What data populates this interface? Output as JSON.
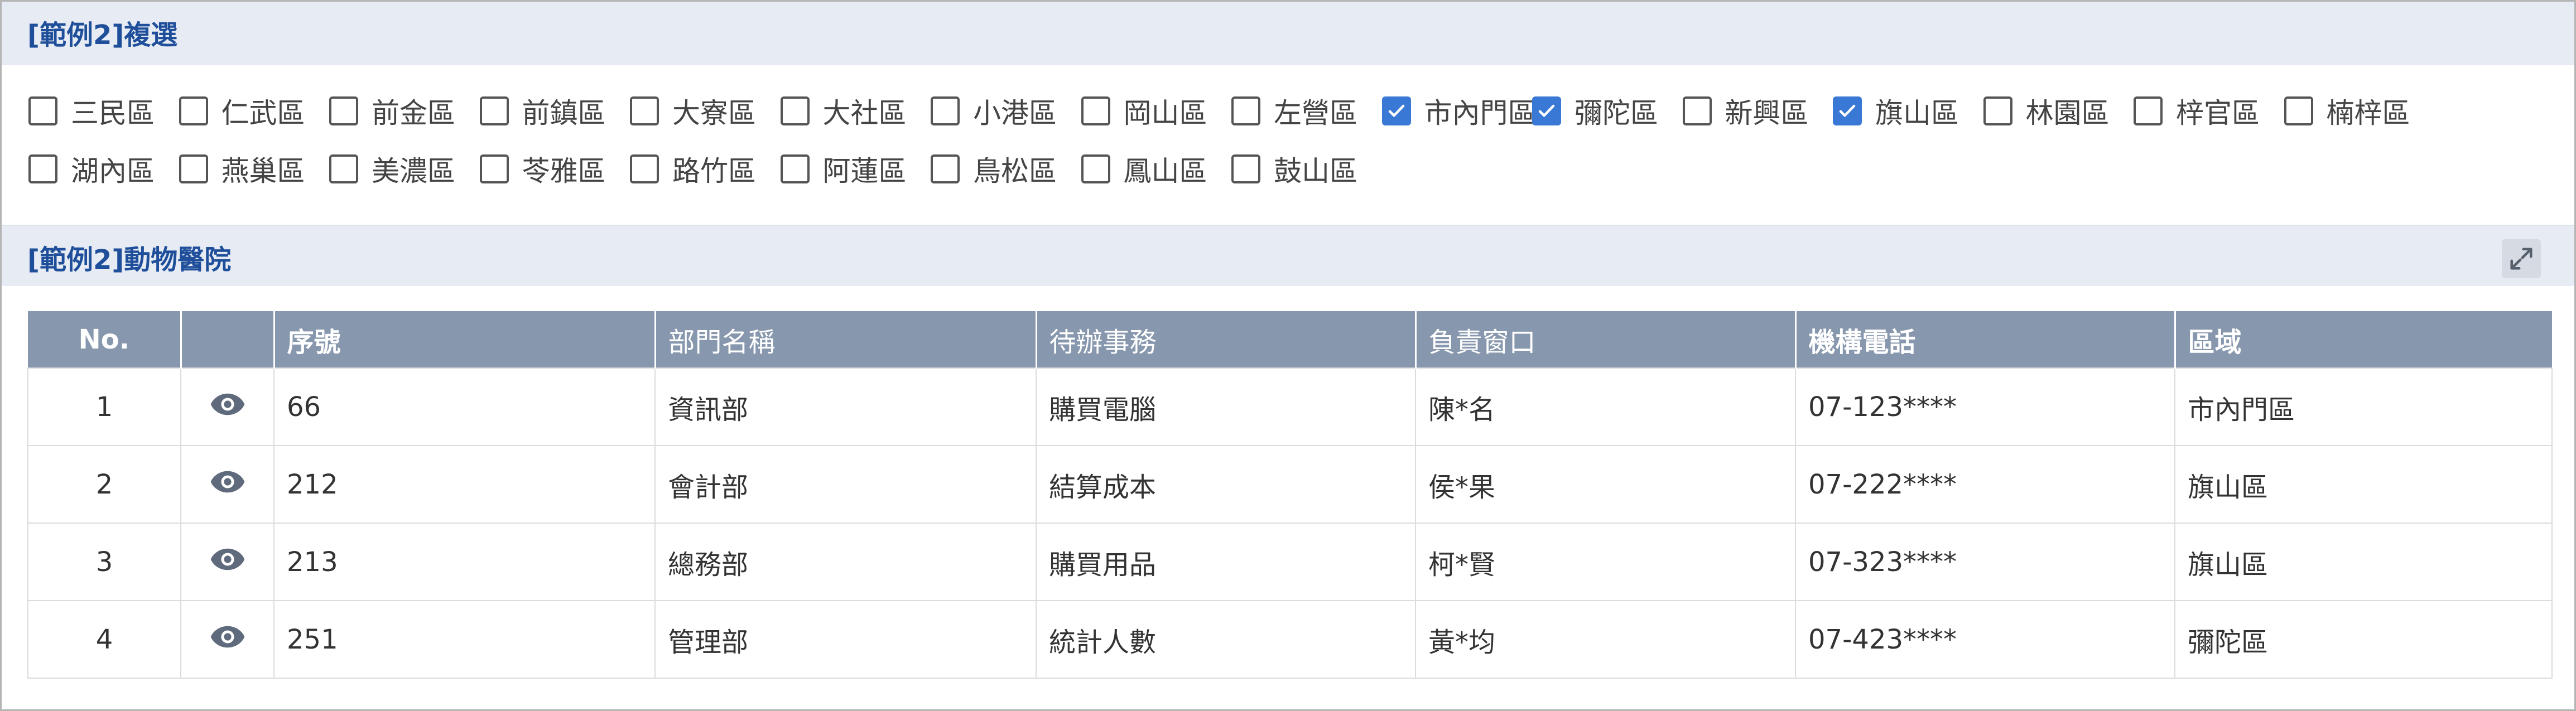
{
  "section1": {
    "title": "[範例2]複選"
  },
  "checkboxes": {
    "row1": [
      {
        "label": "三民區",
        "checked": false
      },
      {
        "label": "仁武區",
        "checked": false
      },
      {
        "label": "前金區",
        "checked": false
      },
      {
        "label": "前鎮區",
        "checked": false
      },
      {
        "label": "大寮區",
        "checked": false
      },
      {
        "label": "大社區",
        "checked": false
      },
      {
        "label": "小港區",
        "checked": false
      },
      {
        "label": "岡山區",
        "checked": false
      },
      {
        "label": "左營區",
        "checked": false
      },
      {
        "label": "市內門區",
        "checked": true
      },
      {
        "label": "彌陀區",
        "checked": true
      },
      {
        "label": "新興區",
        "checked": false
      },
      {
        "label": "旗山區",
        "checked": true
      },
      {
        "label": "林園區",
        "checked": false
      },
      {
        "label": "梓官區",
        "checked": false
      },
      {
        "label": "楠梓區",
        "checked": false
      }
    ],
    "row2": [
      {
        "label": "湖內區",
        "checked": false
      },
      {
        "label": "燕巢區",
        "checked": false
      },
      {
        "label": "美濃區",
        "checked": false
      },
      {
        "label": "苓雅區",
        "checked": false
      },
      {
        "label": "路竹區",
        "checked": false
      },
      {
        "label": "阿蓮區",
        "checked": false
      },
      {
        "label": "鳥松區",
        "checked": false
      },
      {
        "label": "鳳山區",
        "checked": false
      },
      {
        "label": "鼓山區",
        "checked": false
      }
    ]
  },
  "section2": {
    "title": "[範例2]動物醫院",
    "expand_icon": "expand-icon"
  },
  "table": {
    "headers": [
      "No.",
      "",
      "序號",
      "部門名稱",
      "待辦事務",
      "負責窗口",
      "機構電話",
      "區域"
    ],
    "rows": [
      [
        "1",
        "eye-icon",
        "66",
        "資訊部",
        "購買電腦",
        "陳*名",
        "07-123****",
        "市內門區"
      ],
      [
        "2",
        "eye-icon",
        "212",
        "會計部",
        "結算成本",
        "侯*果",
        "07-222****",
        "旗山區"
      ],
      [
        "3",
        "eye-icon",
        "213",
        "總務部",
        "購買用品",
        "柯*賢",
        "07-323****",
        "旗山區"
      ],
      [
        "4",
        "eye-icon",
        "251",
        "管理部",
        "統計人數",
        "黃*均",
        "07-423****",
        "彌陀區"
      ]
    ]
  },
  "colors": {
    "header_bg": "#e7ebf3",
    "title_color": "#1f4f9a",
    "table_header_bg": "#8797ad",
    "checkbox_checked": "#3a78d6"
  }
}
